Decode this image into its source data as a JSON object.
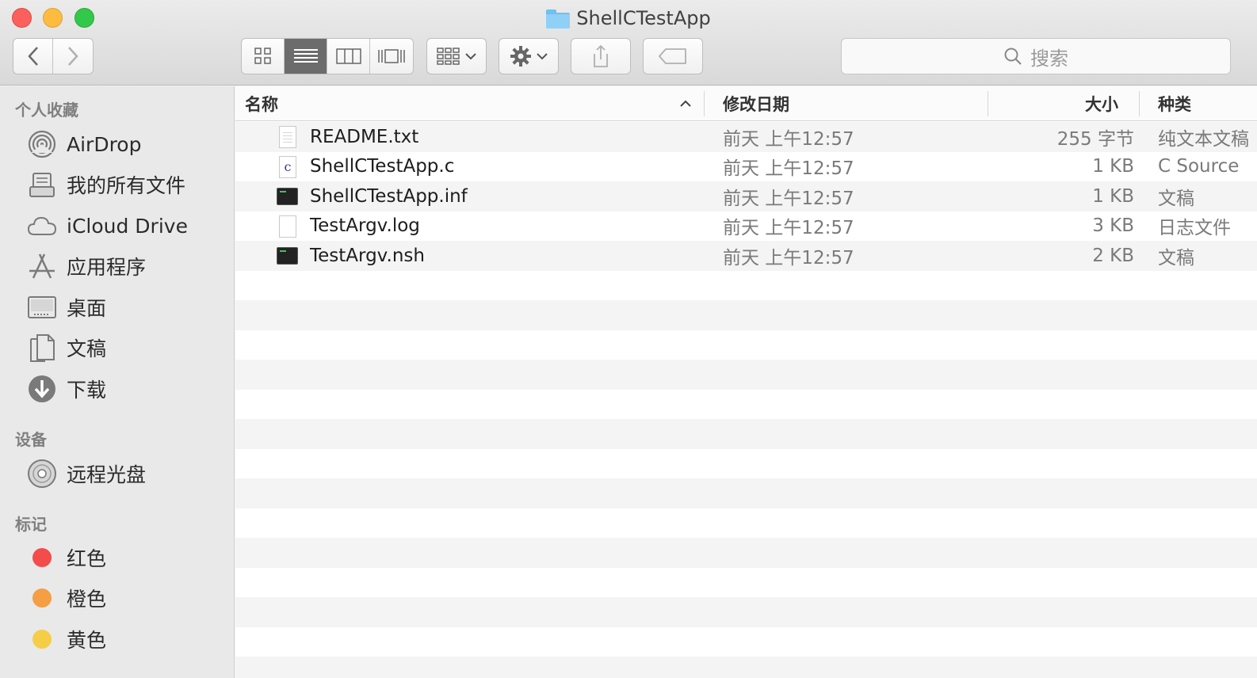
{
  "window": {
    "title": "ShellCTestApp"
  },
  "toolbar": {
    "back_label": "‹",
    "forward_label": "›",
    "search_placeholder": "搜索"
  },
  "sidebar": {
    "favorites_header": "个人收藏",
    "favorites": [
      {
        "label": "AirDrop",
        "icon": "airdrop-icon"
      },
      {
        "label": "我的所有文件",
        "icon": "all-files-icon"
      },
      {
        "label": "iCloud Drive",
        "icon": "cloud-icon"
      },
      {
        "label": "应用程序",
        "icon": "applications-icon"
      },
      {
        "label": "桌面",
        "icon": "desktop-icon"
      },
      {
        "label": "文稿",
        "icon": "documents-icon"
      },
      {
        "label": "下载",
        "icon": "download-icon"
      }
    ],
    "devices_header": "设备",
    "devices": [
      {
        "label": "远程光盘",
        "icon": "disc-icon"
      }
    ],
    "tags_header": "标记",
    "tags": [
      {
        "label": "红色",
        "color": "#f44b4b"
      },
      {
        "label": "橙色",
        "color": "#f59e44"
      },
      {
        "label": "黄色",
        "color": "#f5cd47"
      }
    ]
  },
  "columns": {
    "name": "名称",
    "date": "修改日期",
    "size": "大小",
    "kind": "种类"
  },
  "files": [
    {
      "name": "README.txt",
      "date": "前天 上午12:57",
      "size": "255 字节",
      "kind": "纯文本文稿",
      "icon": "text-file-icon"
    },
    {
      "name": "ShellCTestApp.c",
      "date": "前天 上午12:57",
      "size": "1 KB",
      "kind": "C Source",
      "icon": "c-source-icon"
    },
    {
      "name": "ShellCTestApp.inf",
      "date": "前天 上午12:57",
      "size": "1 KB",
      "kind": "文稿",
      "icon": "terminal-file-icon"
    },
    {
      "name": "TestArgv.log",
      "date": "前天 上午12:57",
      "size": "3 KB",
      "kind": "日志文件",
      "icon": "blank-file-icon"
    },
    {
      "name": "TestArgv.nsh",
      "date": "前天 上午12:57",
      "size": "2 KB",
      "kind": "文稿",
      "icon": "terminal-file-icon"
    }
  ]
}
